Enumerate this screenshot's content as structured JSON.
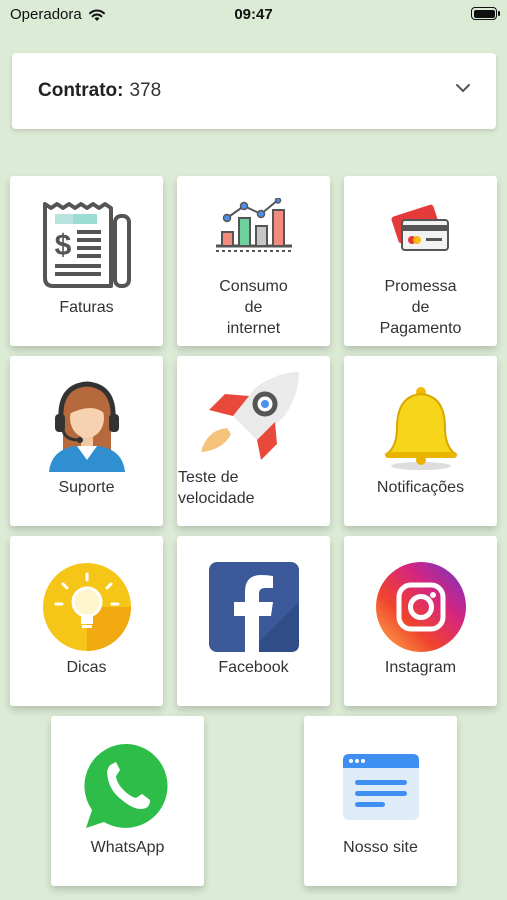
{
  "status_bar": {
    "carrier": "Operadora",
    "time": "09:47"
  },
  "contract": {
    "label": "Contrato:",
    "value": "378"
  },
  "menu": {
    "faturas": "Faturas",
    "consumo": [
      "Consumo",
      "de",
      "internet"
    ],
    "promessa": [
      "Promessa",
      "de",
      "Pagamento"
    ],
    "suporte": "Suporte",
    "velocidade": [
      "Teste de",
      "velocidade"
    ],
    "notificacoes": "Notificações",
    "dicas": "Dicas",
    "facebook": "Facebook",
    "instagram": "Instagram",
    "whatsapp": "WhatsApp",
    "site": "Nosso site"
  },
  "colors": {
    "background": "#dcebd6",
    "facebook": "#3b5998",
    "whatsapp": "#2fbd4a",
    "bell": "#f6d51a"
  }
}
